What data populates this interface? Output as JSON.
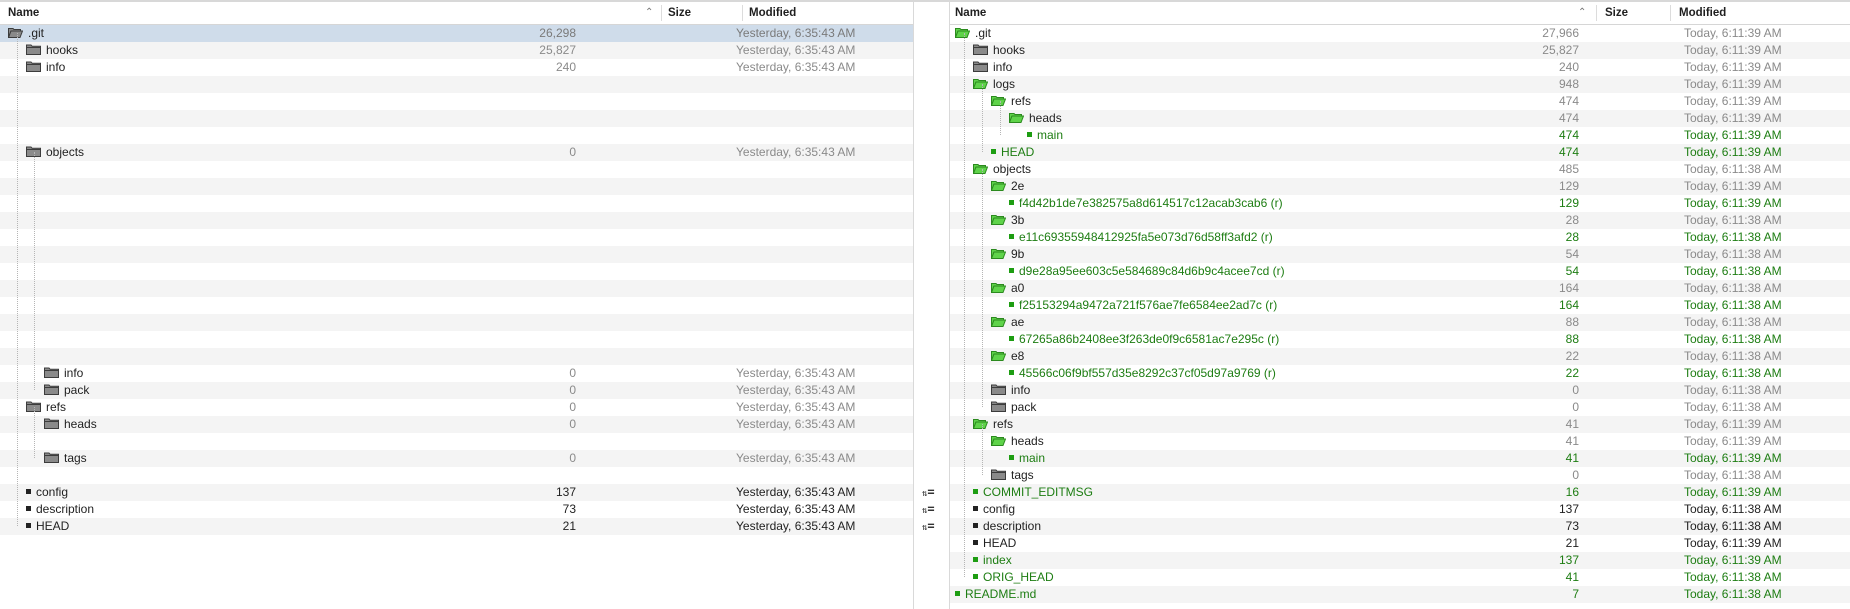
{
  "left": {
    "headers": {
      "name": "Name",
      "size": "Size",
      "modified": "Modified"
    },
    "rows": [
      {
        "name": ".git",
        "size": "26,298",
        "modified": "Yesterday, 6:35:43 AM",
        "kind": "folder",
        "depth": 0,
        "style": "sel"
      },
      {
        "name": "hooks",
        "size": "25,827",
        "modified": "Yesterday, 6:35:43 AM",
        "kind": "folder",
        "depth": 1,
        "style": "muted"
      },
      {
        "name": "info",
        "size": "240",
        "modified": "Yesterday, 6:35:43 AM",
        "kind": "folder",
        "depth": 1,
        "style": "muted"
      },
      {
        "name": "",
        "size": "",
        "modified": "",
        "kind": "blank"
      },
      {
        "name": "",
        "size": "",
        "modified": "",
        "kind": "blank"
      },
      {
        "name": "",
        "size": "",
        "modified": "",
        "kind": "blank"
      },
      {
        "name": "",
        "size": "",
        "modified": "",
        "kind": "blank"
      },
      {
        "name": "objects",
        "size": "0",
        "modified": "Yesterday, 6:35:43 AM",
        "kind": "folder",
        "depth": 1,
        "style": "muted"
      },
      {
        "name": "",
        "size": "",
        "modified": "",
        "kind": "blank"
      },
      {
        "name": "",
        "size": "",
        "modified": "",
        "kind": "blank"
      },
      {
        "name": "",
        "size": "",
        "modified": "",
        "kind": "blank"
      },
      {
        "name": "",
        "size": "",
        "modified": "",
        "kind": "blank"
      },
      {
        "name": "",
        "size": "",
        "modified": "",
        "kind": "blank"
      },
      {
        "name": "",
        "size": "",
        "modified": "",
        "kind": "blank"
      },
      {
        "name": "",
        "size": "",
        "modified": "",
        "kind": "blank"
      },
      {
        "name": "",
        "size": "",
        "modified": "",
        "kind": "blank"
      },
      {
        "name": "",
        "size": "",
        "modified": "",
        "kind": "blank"
      },
      {
        "name": "",
        "size": "",
        "modified": "",
        "kind": "blank"
      },
      {
        "name": "",
        "size": "",
        "modified": "",
        "kind": "blank"
      },
      {
        "name": "",
        "size": "",
        "modified": "",
        "kind": "blank"
      },
      {
        "name": "info",
        "size": "0",
        "modified": "Yesterday, 6:35:43 AM",
        "kind": "folder",
        "depth": 2,
        "style": "muted"
      },
      {
        "name": "pack",
        "size": "0",
        "modified": "Yesterday, 6:35:43 AM",
        "kind": "folder",
        "depth": 2,
        "style": "muted"
      },
      {
        "name": "refs",
        "size": "0",
        "modified": "Yesterday, 6:35:43 AM",
        "kind": "folder",
        "depth": 1,
        "style": "muted"
      },
      {
        "name": "heads",
        "size": "0",
        "modified": "Yesterday, 6:35:43 AM",
        "kind": "folder",
        "depth": 2,
        "style": "muted"
      },
      {
        "name": "",
        "size": "",
        "modified": "",
        "kind": "blank"
      },
      {
        "name": "tags",
        "size": "0",
        "modified": "Yesterday, 6:35:43 AM",
        "kind": "folder",
        "depth": 2,
        "style": "muted"
      },
      {
        "name": "",
        "size": "",
        "modified": "",
        "kind": "blank"
      },
      {
        "name": "config",
        "size": "137",
        "modified": "Yesterday, 6:35:43 AM",
        "kind": "file",
        "depth": 1,
        "style": "bold"
      },
      {
        "name": "description",
        "size": "73",
        "modified": "Yesterday, 6:35:43 AM",
        "kind": "file",
        "depth": 1,
        "style": "bold"
      },
      {
        "name": "HEAD",
        "size": "21",
        "modified": "Yesterday, 6:35:43 AM",
        "kind": "file",
        "depth": 1,
        "style": "bold"
      }
    ]
  },
  "right": {
    "headers": {
      "name": "Name",
      "size": "Size",
      "modified": "Modified"
    },
    "rows": [
      {
        "name": ".git",
        "size": "27,966",
        "modified": "Today, 6:11:39 AM",
        "kind": "folder-open",
        "depth": 0,
        "style": "muted"
      },
      {
        "name": "hooks",
        "size": "25,827",
        "modified": "Today, 6:11:39 AM",
        "kind": "folder",
        "depth": 1,
        "style": "muted"
      },
      {
        "name": "info",
        "size": "240",
        "modified": "Today, 6:11:39 AM",
        "kind": "folder",
        "depth": 1,
        "style": "muted"
      },
      {
        "name": "logs",
        "size": "948",
        "modified": "Today, 6:11:39 AM",
        "kind": "folder-open",
        "depth": 1,
        "style": "muted"
      },
      {
        "name": "refs",
        "size": "474",
        "modified": "Today, 6:11:39 AM",
        "kind": "folder-open",
        "depth": 2,
        "style": "muted"
      },
      {
        "name": "heads",
        "size": "474",
        "modified": "Today, 6:11:39 AM",
        "kind": "folder-open",
        "depth": 3,
        "style": "muted"
      },
      {
        "name": "main",
        "size": "474",
        "modified": "Today, 6:11:39 AM",
        "kind": "file-g",
        "depth": 4,
        "style": "green"
      },
      {
        "name": "HEAD",
        "size": "474",
        "modified": "Today, 6:11:39 AM",
        "kind": "file-g",
        "depth": 2,
        "style": "green"
      },
      {
        "name": "objects",
        "size": "485",
        "modified": "Today, 6:11:38 AM",
        "kind": "folder-open",
        "depth": 1,
        "style": "muted"
      },
      {
        "name": "2e",
        "size": "129",
        "modified": "Today, 6:11:39 AM",
        "kind": "folder-open",
        "depth": 2,
        "style": "muted"
      },
      {
        "name": "f4d42b1de7e382575a8d614517c12acab3cab6 (r)",
        "size": "129",
        "modified": "Today, 6:11:39 AM",
        "kind": "file-g",
        "depth": 3,
        "style": "green"
      },
      {
        "name": "3b",
        "size": "28",
        "modified": "Today, 6:11:38 AM",
        "kind": "folder-open",
        "depth": 2,
        "style": "muted"
      },
      {
        "name": "e11c69355948412925fa5e073d76d58ff3afd2 (r)",
        "size": "28",
        "modified": "Today, 6:11:38 AM",
        "kind": "file-g",
        "depth": 3,
        "style": "green"
      },
      {
        "name": "9b",
        "size": "54",
        "modified": "Today, 6:11:38 AM",
        "kind": "folder-open",
        "depth": 2,
        "style": "muted"
      },
      {
        "name": "d9e28a95ee603c5e584689c84d6b9c4acee7cd (r)",
        "size": "54",
        "modified": "Today, 6:11:38 AM",
        "kind": "file-g",
        "depth": 3,
        "style": "green"
      },
      {
        "name": "a0",
        "size": "164",
        "modified": "Today, 6:11:38 AM",
        "kind": "folder-open",
        "depth": 2,
        "style": "muted"
      },
      {
        "name": "f25153294a9472a721f576ae7fe6584ee2ad7c (r)",
        "size": "164",
        "modified": "Today, 6:11:38 AM",
        "kind": "file-g",
        "depth": 3,
        "style": "green"
      },
      {
        "name": "ae",
        "size": "88",
        "modified": "Today, 6:11:38 AM",
        "kind": "folder-open",
        "depth": 2,
        "style": "muted"
      },
      {
        "name": "67265a86b2408ee3f263de0f9c6581ac7e295c (r)",
        "size": "88",
        "modified": "Today, 6:11:38 AM",
        "kind": "file-g",
        "depth": 3,
        "style": "green"
      },
      {
        "name": "e8",
        "size": "22",
        "modified": "Today, 6:11:38 AM",
        "kind": "folder-open",
        "depth": 2,
        "style": "muted"
      },
      {
        "name": "45566c06f9bf557d35e8292c37cf05d97a9769 (r)",
        "size": "22",
        "modified": "Today, 6:11:38 AM",
        "kind": "file-g",
        "depth": 3,
        "style": "green"
      },
      {
        "name": "info",
        "size": "0",
        "modified": "Today, 6:11:38 AM",
        "kind": "folder",
        "depth": 2,
        "style": "muted"
      },
      {
        "name": "pack",
        "size": "0",
        "modified": "Today, 6:11:38 AM",
        "kind": "folder",
        "depth": 2,
        "style": "muted"
      },
      {
        "name": "refs",
        "size": "41",
        "modified": "Today, 6:11:39 AM",
        "kind": "folder-open",
        "depth": 1,
        "style": "muted"
      },
      {
        "name": "heads",
        "size": "41",
        "modified": "Today, 6:11:39 AM",
        "kind": "folder-open",
        "depth": 2,
        "style": "muted"
      },
      {
        "name": "main",
        "size": "41",
        "modified": "Today, 6:11:39 AM",
        "kind": "file-g",
        "depth": 3,
        "style": "green"
      },
      {
        "name": "tags",
        "size": "0",
        "modified": "Today, 6:11:38 AM",
        "kind": "folder",
        "depth": 2,
        "style": "muted"
      },
      {
        "name": "COMMIT_EDITMSG",
        "size": "16",
        "modified": "Today, 6:11:39 AM",
        "kind": "file-g",
        "depth": 1,
        "style": "green"
      },
      {
        "name": "config",
        "size": "137",
        "modified": "Today, 6:11:38 AM",
        "kind": "file",
        "depth": 1,
        "style": "bold"
      },
      {
        "name": "description",
        "size": "73",
        "modified": "Today, 6:11:38 AM",
        "kind": "file",
        "depth": 1,
        "style": "bold"
      },
      {
        "name": "HEAD",
        "size": "21",
        "modified": "Today, 6:11:39 AM",
        "kind": "file",
        "depth": 1,
        "style": "bold"
      },
      {
        "name": "index",
        "size": "137",
        "modified": "Today, 6:11:39 AM",
        "kind": "file-g",
        "depth": 1,
        "style": "green"
      },
      {
        "name": "ORIG_HEAD",
        "size": "41",
        "modified": "Today, 6:11:38 AM",
        "kind": "file-g",
        "depth": 1,
        "style": "green"
      },
      {
        "name": "README.md",
        "size": "7",
        "modified": "Today, 6:11:38 AM",
        "kind": "file-g",
        "depth": 0,
        "style": "green"
      }
    ]
  },
  "gutter_rows": [
    27,
    28,
    29
  ],
  "colors": {
    "selection": "#cfdcea",
    "stripe": "#f4f4f4",
    "green": "#1d7d12",
    "folder_green": "#5fd34a",
    "folder_gray": "#8a8a8a"
  },
  "icons": [
    "folder-icon",
    "folder-open-icon",
    "file-icon",
    "equal-icon"
  ]
}
